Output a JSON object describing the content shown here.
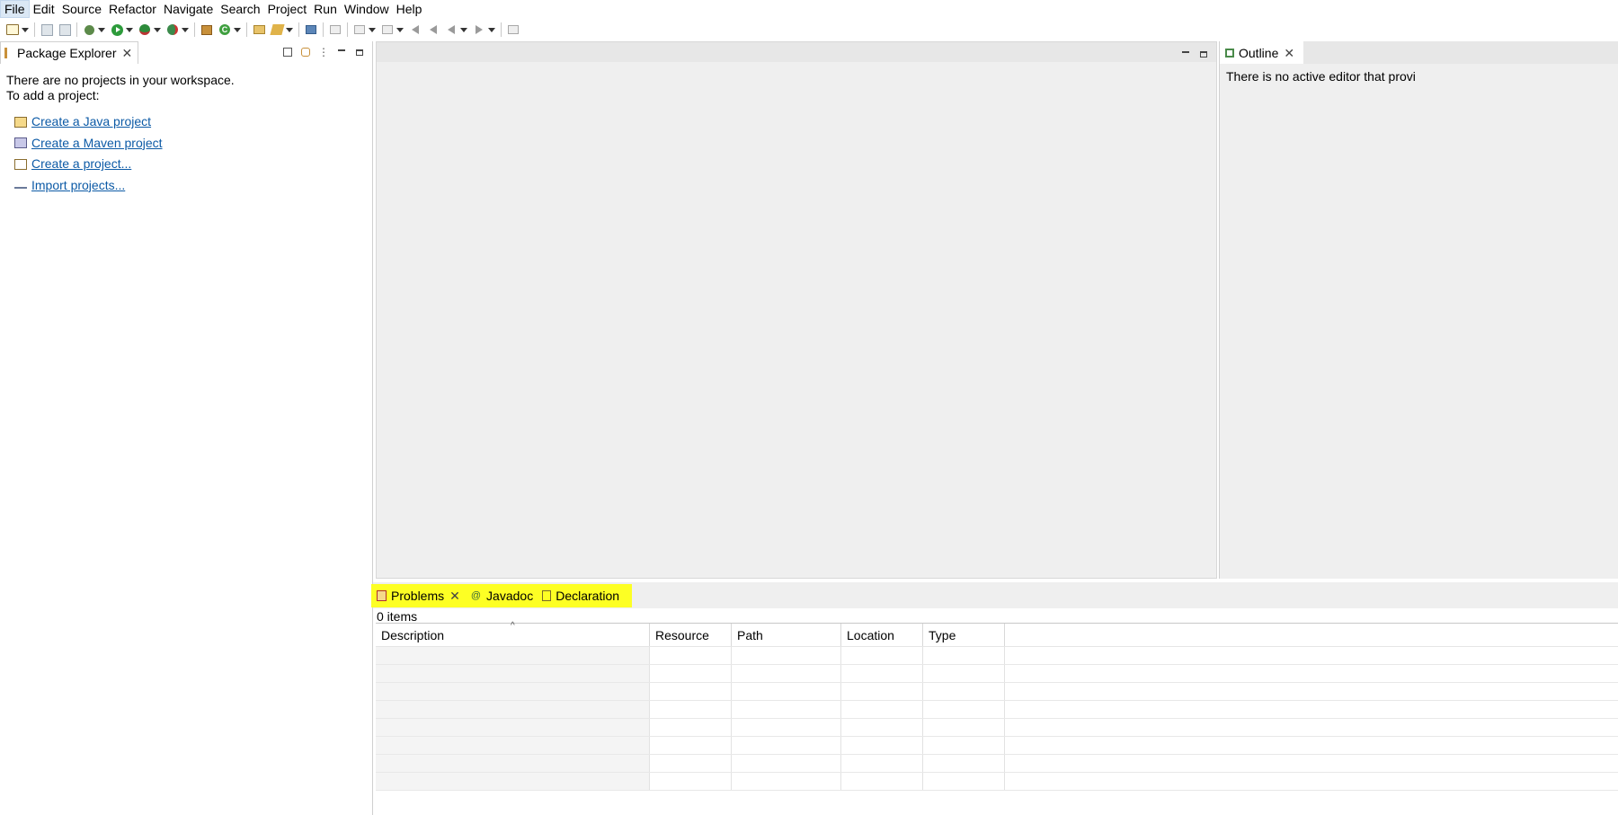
{
  "menu": {
    "items": [
      "File",
      "Edit",
      "Source",
      "Refactor",
      "Navigate",
      "Search",
      "Project",
      "Run",
      "Window",
      "Help"
    ]
  },
  "toolbar": {
    "icons": [
      "new-wizard-icon",
      "save-icon",
      "save-all-icon",
      "debug-icon",
      "run-icon",
      "coverage-icon",
      "external-tools-icon",
      "new-package-icon",
      "new-class-icon",
      "open-type-icon",
      "search-icon",
      "open-console-icon",
      "toggle-mark-icon",
      "next-annotation-icon",
      "previous-annotation-icon",
      "last-edit-icon",
      "back-icon",
      "forward-icon",
      "pin-editor-icon"
    ]
  },
  "package_explorer": {
    "tab_label": "Package Explorer",
    "message_line1": "There are no projects in your workspace.",
    "message_line2": "To add a project:",
    "links": [
      {
        "label": "Create a Java project",
        "icon": "java-project-icon"
      },
      {
        "label": "Create a Maven project",
        "icon": "maven-project-icon"
      },
      {
        "label": "Create a project...",
        "icon": "new-project-icon"
      },
      {
        "label": "Import projects...",
        "icon": "import-icon"
      }
    ]
  },
  "outline": {
    "tab_label": "Outline",
    "message": "There is no active editor that provi"
  },
  "bottom_panel": {
    "tabs": [
      {
        "label": "Problems",
        "icon": "problems-icon",
        "active": true
      },
      {
        "label": "Javadoc",
        "icon": "javadoc-icon",
        "active": false
      },
      {
        "label": "Declaration",
        "icon": "declaration-icon",
        "active": false
      }
    ],
    "items_count": "0 items",
    "columns": [
      "Description",
      "Resource",
      "Path",
      "Location",
      "Type"
    ]
  },
  "colors": {
    "highlight": "#fdff24",
    "link": "#0c5aa6",
    "panel_bg": "#efefef"
  }
}
